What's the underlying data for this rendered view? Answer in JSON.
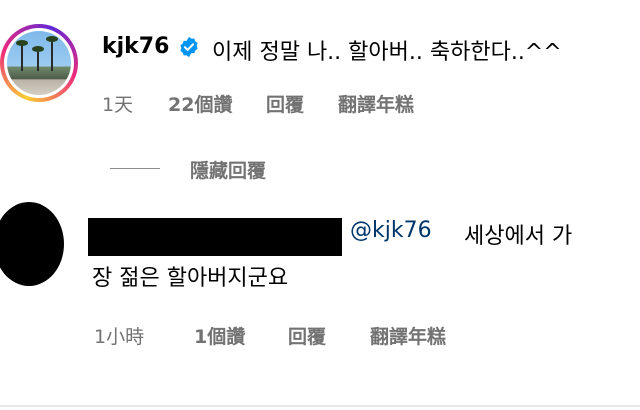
{
  "comment": {
    "username": "kjk76",
    "verified_icon": "verified-badge-icon",
    "text": "이제 정말 나.. 할아버.. 축하한다..^^",
    "time": "1天",
    "likes": "22個讚",
    "reply_label": "回覆",
    "translate_label": "翻譯年糕"
  },
  "replies_toggle": {
    "label": "隱藏回覆"
  },
  "reply": {
    "mention": "@kjk76",
    "text_line1": "세상에서 가",
    "text_line2": "장 젊은 할아버지군요",
    "time": "1小時",
    "likes": "1個讚",
    "reply_label": "回覆",
    "translate_label": "翻譯年糕"
  },
  "colors": {
    "mention": "#00376b",
    "meta": "#737373",
    "verified": "#0095f6"
  }
}
